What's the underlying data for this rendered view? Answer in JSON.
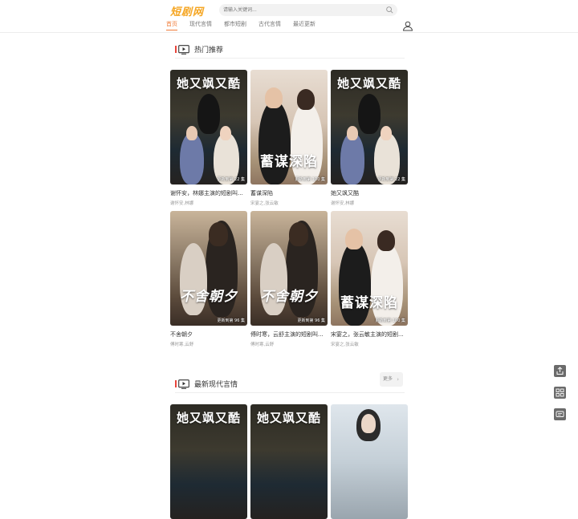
{
  "header": {
    "logo": "短剧网",
    "search_placeholder": "请输入关键词...",
    "nav": [
      {
        "label": "首页",
        "active": true
      },
      {
        "label": "现代言情",
        "active": false
      },
      {
        "label": "都市短剧",
        "active": false
      },
      {
        "label": "古代言情",
        "active": false
      },
      {
        "label": "最近更新",
        "active": false
      }
    ]
  },
  "sections": [
    {
      "title": "热门推荐",
      "cards": [
        {
          "poster_text": "她又飒又酷",
          "episodes": "更新到第 22 集",
          "title": "谢怀安，林娜主演的短剧叫...",
          "actors": "谢怀安,林娜",
          "style": "dark"
        },
        {
          "poster_text": "蓄谋深陷",
          "episodes": "更新到第 100 集",
          "title": "蓄谋深陷",
          "actors": "宋宴之,张云敏",
          "style": "light"
        },
        {
          "poster_text": "她又飒又酷",
          "episodes": "更新到第 22 集",
          "title": "她又飒又酷",
          "actors": "谢怀安,林娜",
          "style": "dark"
        },
        {
          "poster_text": "不舍朝夕",
          "episodes": "更新到第 96 集",
          "title": "不舍朝夕",
          "actors": "傅时寒,云舒",
          "style": "warm"
        },
        {
          "poster_text": "不舍朝夕",
          "episodes": "更新到第 96 集",
          "title": "傅时寒，云舒主演的短剧叫...",
          "actors": "傅时寒,云舒",
          "style": "warm"
        },
        {
          "poster_text": "蓄谋深陷",
          "episodes": "更新到第 100 集",
          "title": "宋宴之，张云敏主演的短剧...",
          "actors": "宋宴之,张云敏",
          "style": "light"
        }
      ]
    },
    {
      "title": "最新现代言情",
      "more_label": "更多",
      "cards": [
        {
          "poster_text": "她又飒又酷",
          "style": "dark"
        },
        {
          "poster_text": "她又飒又酷",
          "style": "dark"
        },
        {
          "poster_text": "",
          "style": "photo"
        }
      ]
    }
  ],
  "colors": {
    "accent": "#f07c3a",
    "logo": "#f5a623",
    "section_bar": "#e8463c"
  },
  "side_buttons": [
    "share-icon",
    "grid-icon",
    "chat-icon"
  ]
}
